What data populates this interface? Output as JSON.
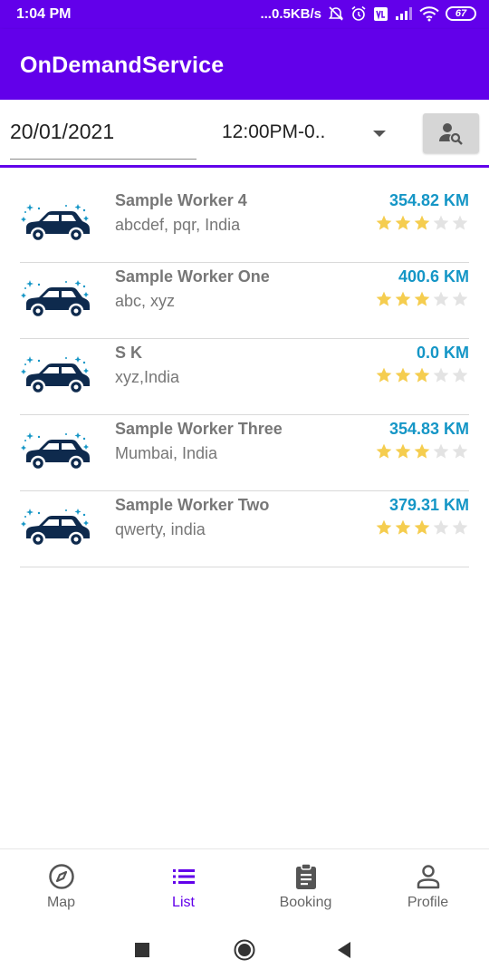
{
  "status_bar": {
    "time": "1:04 PM",
    "network_speed": "...0.5KB/s",
    "battery": "67",
    "icons": [
      "alarm-off-icon",
      "alarm-icon",
      "volte-icon",
      "signal-icon",
      "wifi-icon",
      "battery-icon"
    ]
  },
  "app_bar": {
    "title": "OnDemandService"
  },
  "filter": {
    "date": "20/01/2021",
    "time_slot": "12:00PM-0..",
    "search_icon": "person-search-icon"
  },
  "workers": [
    {
      "name": "Sample Worker 4",
      "address": "abcdef, pqr, India",
      "distance": "354.82 KM",
      "rating": 3,
      "max_rating": 5
    },
    {
      "name": "Sample Worker One",
      "address": "abc, xyz",
      "distance": "400.6 KM",
      "rating": 3,
      "max_rating": 5
    },
    {
      "name": "S K",
      "address": "xyz,India",
      "distance": "0.0 KM",
      "rating": 3,
      "max_rating": 5
    },
    {
      "name": "Sample Worker Three",
      "address": "Mumbai, India",
      "distance": "354.83 KM",
      "rating": 3,
      "max_rating": 5
    },
    {
      "name": "Sample Worker Two",
      "address": "qwerty, india",
      "distance": "379.31 KM",
      "rating": 3,
      "max_rating": 5
    }
  ],
  "bottom_nav": {
    "items": [
      {
        "label": "Map",
        "icon": "compass-icon",
        "active": false
      },
      {
        "label": "List",
        "icon": "list-icon",
        "active": true
      },
      {
        "label": "Booking",
        "icon": "clipboard-icon",
        "active": false
      },
      {
        "label": "Profile",
        "icon": "person-icon",
        "active": false
      }
    ]
  },
  "colors": {
    "primary": "#6200ea",
    "distance": "#1596c6",
    "star_filled": "#f5cd4f",
    "star_empty": "#e3e3e3",
    "car": "#0e2a4d"
  }
}
